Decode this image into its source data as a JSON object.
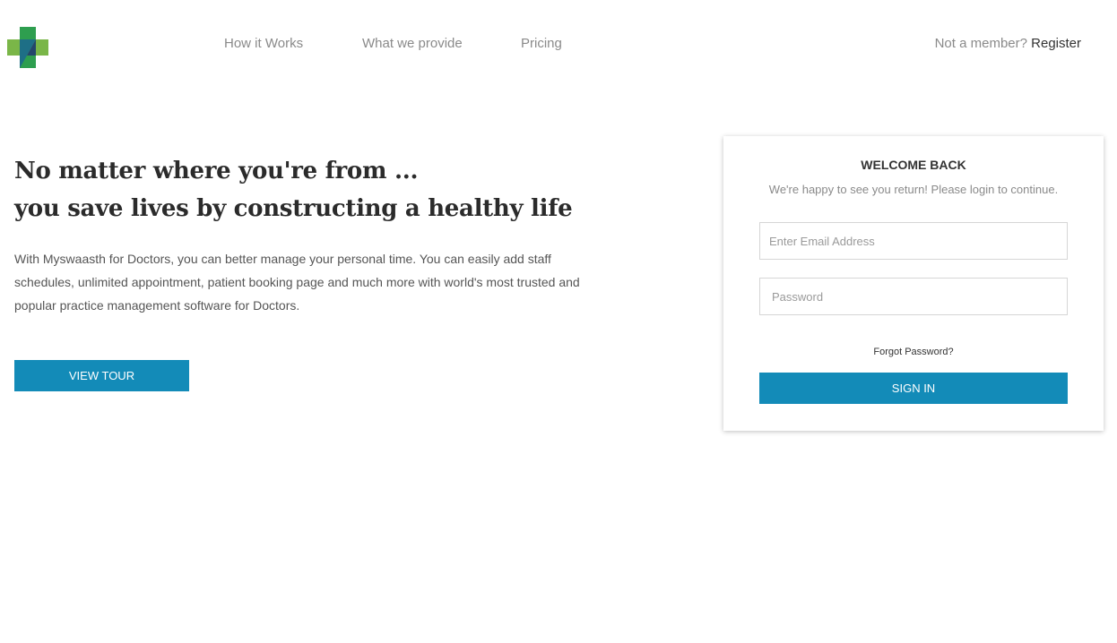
{
  "logo": {
    "icon": "medical-cross-logo-icon",
    "colors": {
      "green": "#2e9e4f",
      "light_green": "#7ab648",
      "teal": "#1e6f86",
      "navy": "#24466b"
    }
  },
  "nav": {
    "items": [
      {
        "label": "How it Works"
      },
      {
        "label": "What we provide"
      },
      {
        "label": "Pricing"
      }
    ],
    "member_prompt": "Not a member?",
    "register_label": "Register"
  },
  "hero": {
    "headline_line1": "No matter where you're from ...",
    "headline_line2": "you save lives by constructing a healthy life",
    "description": "With Myswaasth for Doctors, you can better manage your personal time. You can easily add staff schedules, unlimited appointment, patient booking page and much more with world's most trusted and popular practice management software for Doctors.",
    "tour_button": "VIEW TOUR"
  },
  "login": {
    "title": "WELCOME BACK",
    "subtitle": "We're happy to see you return! Please login to continue.",
    "email_placeholder": "Enter Email Address",
    "password_placeholder": "Password",
    "forgot_label": "Forgot Password?",
    "signin_button": "SIGN IN"
  },
  "colors": {
    "accent": "#138bb8",
    "muted_text": "#8a8a8a"
  }
}
